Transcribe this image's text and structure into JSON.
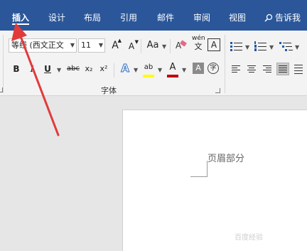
{
  "tabs": [
    "插入",
    "设计",
    "布局",
    "引用",
    "邮件",
    "审阅",
    "视图"
  ],
  "tell_me": "告诉我",
  "font": {
    "name": "等线 (西文正文",
    "size": "11",
    "grow_label": "A",
    "shrink_label": "A",
    "case_label": "Aa",
    "phonetic_top": "wén",
    "phonetic_bottom": "文",
    "border_label": "A",
    "bold": "B",
    "italic": "I",
    "underline": "U",
    "strike": "abc",
    "subscript": "x₂",
    "superscript": "x²",
    "effects_label": "A",
    "highlight_label": "ab",
    "color_label": "A",
    "shade_label": "A",
    "enclose_label": "字",
    "group_label": "字体"
  },
  "document": {
    "header_text": "页眉部分",
    "watermark": "百度经验"
  },
  "colors": {
    "tab_bar": "#2b579a",
    "arrow": "#e23a3a",
    "highlight": "#ffff00",
    "font_color": "#c00000"
  }
}
